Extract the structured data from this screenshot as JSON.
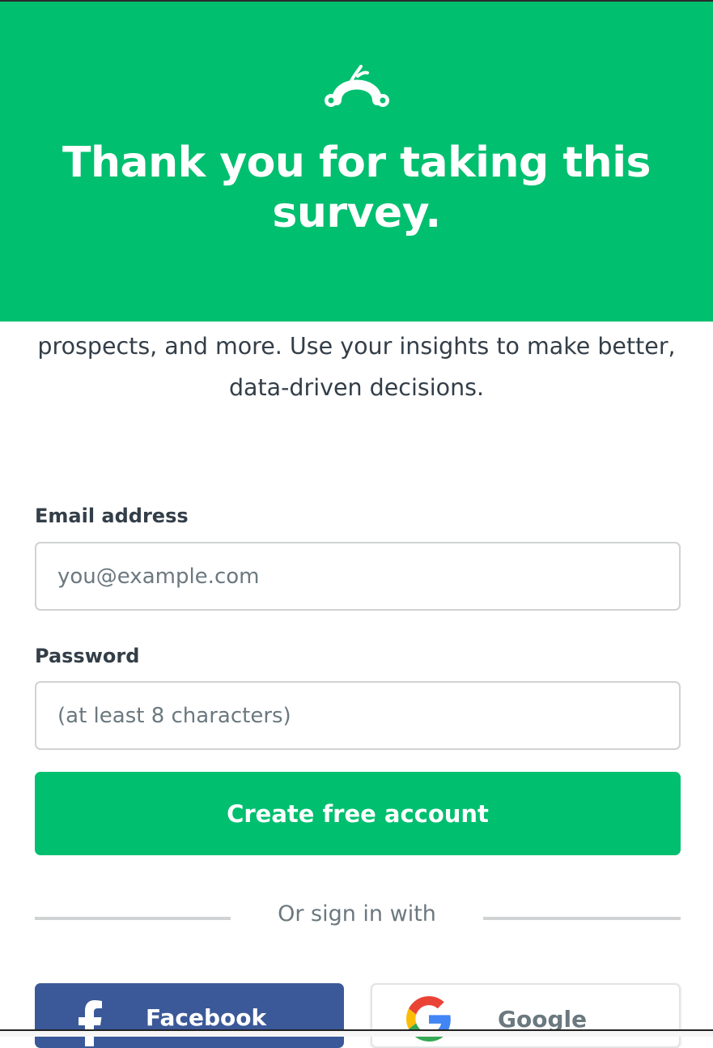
{
  "header": {
    "logo_icon": "surveymonkey-logo-icon",
    "headline": "Thank you for taking this survey.",
    "background_color": "#00bf6f"
  },
  "intro": {
    "text": "prospects, and more. Use your insights to make better, data-driven decisions."
  },
  "form": {
    "email": {
      "label": "Email address",
      "placeholder": "you@example.com",
      "value": ""
    },
    "password": {
      "label": "Password",
      "placeholder": "(at least 8 characters)",
      "value": ""
    },
    "submit_label": "Create free account",
    "submit_color": "#00bf6f"
  },
  "social": {
    "divider_text": "Or sign in with",
    "facebook": {
      "label": "Facebook",
      "icon": "facebook-icon",
      "color": "#3b5998"
    },
    "google": {
      "label": "Google",
      "icon": "google-icon"
    }
  }
}
